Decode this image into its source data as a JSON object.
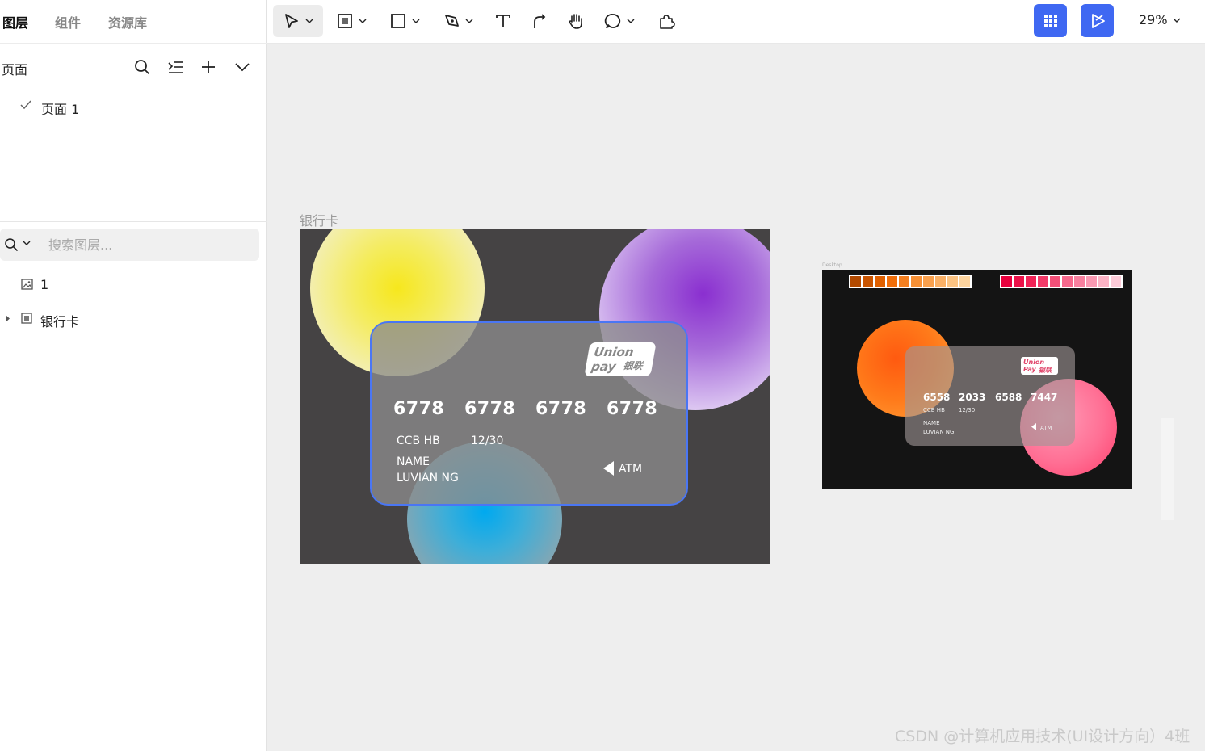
{
  "left_panel": {
    "tabs": [
      "图层",
      "组件",
      "资源库"
    ],
    "pages_title": "页面",
    "pages": [
      {
        "label": "页面 1",
        "selected": true
      }
    ],
    "search_placeholder": "搜索图层...",
    "layers": [
      {
        "label": "1",
        "icon": "image-icon"
      },
      {
        "label": "银行卡",
        "icon": "frame-icon",
        "collapsed": true
      }
    ]
  },
  "toolbar": {
    "tools": [
      "move-tool",
      "frame-tool",
      "shape-tool",
      "pen-tool",
      "text-tool",
      "connector-tool",
      "hand-tool",
      "comment-tool",
      "plugin-tool"
    ],
    "zoom": "29%",
    "accent_color": "#3f68f2"
  },
  "canvas": {
    "frame_label": "银行卡",
    "card": {
      "brand_line1": "Union pay",
      "brand_line2": "银联",
      "numbers": [
        "6778",
        "6778",
        "6778",
        "6778"
      ],
      "bank": "CCB HB",
      "expiry": "12/30",
      "name_label": "NAME",
      "name_value": "LUVIAN NG",
      "atm": "ATM"
    },
    "preview": {
      "frame_label": "Desktop",
      "card": {
        "brand_line1": "Union Pay",
        "brand_line2": "银联",
        "numbers": [
          "6558",
          "2033",
          "6588",
          "7447"
        ],
        "bank": "CCB HB",
        "expiry": "12/30",
        "name_label": "NAME",
        "name_value": "LUVIAN NG",
        "atm": "ATM"
      },
      "orange_palette": [
        "#b34a00",
        "#c95400",
        "#e06000",
        "#f06e0a",
        "#f57f1f",
        "#f79035",
        "#f9a04d",
        "#fab066",
        "#fcc382",
        "#fdd49e"
      ],
      "pink_palette": [
        "#e8003d",
        "#ec1249",
        "#f02457",
        "#f23a68",
        "#f45079",
        "#f6688c",
        "#f8809f",
        "#fa99b2",
        "#fcb3c5",
        "#fdcbd8"
      ]
    }
  },
  "watermark": "CSDN @计算机应用技术(UI设计方向）4班"
}
